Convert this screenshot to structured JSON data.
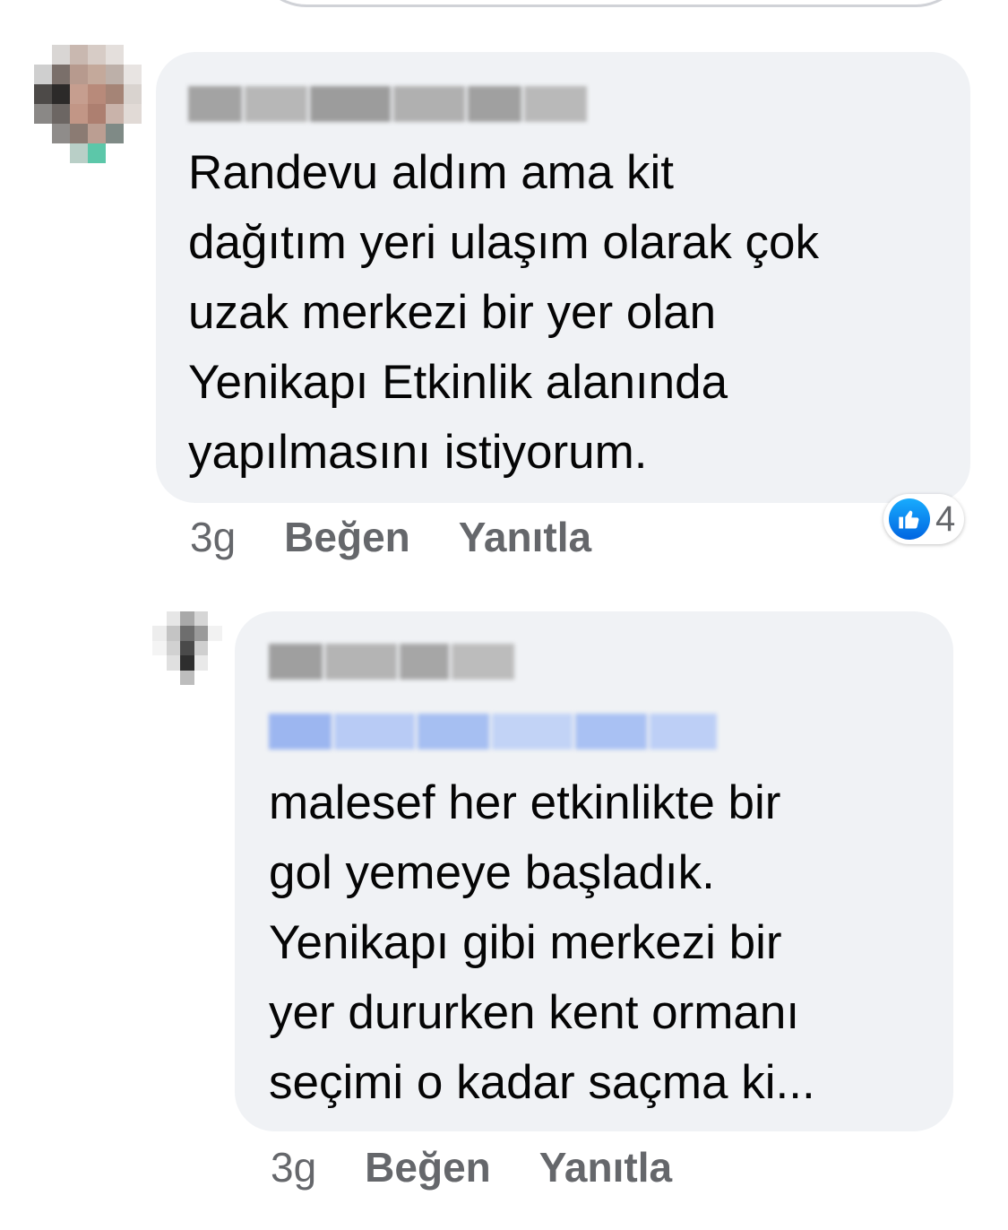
{
  "comments": [
    {
      "text": "Randevu aldım ama kit\ndağıtım yeri ulaşım olarak çok\nuzak merkezi bir yer olan\nYenikapı Etkinlik alanında\nyapılmasını istiyorum.",
      "time": "3g",
      "like_label": "Beğen",
      "reply_label": "Yanıtla",
      "reaction_count": "4"
    },
    {
      "text": "malesef  her etkinlikte bir\ngol yemeye başladık.\nYenikapı gibi merkezi bir\nyer dururken kent ormanı\nseçimi o kadar saçma ki...",
      "time": "3g",
      "like_label": "Beğen",
      "reply_label": "Yanıtla"
    }
  ],
  "colors": {
    "bubble": "#f0f2f5",
    "meta_text": "#65676b",
    "mention_blue": "#1877f2",
    "like_blue": "#0165e1"
  },
  "icons": [
    "thumbs-up-icon",
    "avatar"
  ]
}
